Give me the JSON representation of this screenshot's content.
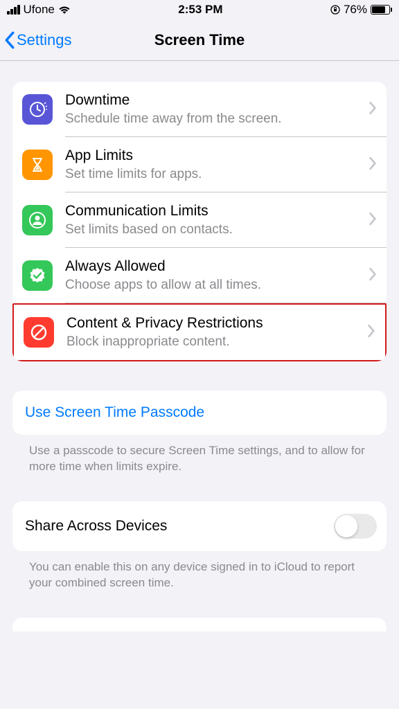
{
  "status": {
    "carrier": "Ufone",
    "time": "2:53 PM",
    "battery_percent": "76%"
  },
  "nav": {
    "back_label": "Settings",
    "title": "Screen Time"
  },
  "rows": [
    {
      "title": "Downtime",
      "sub": "Schedule time away from the screen."
    },
    {
      "title": "App Limits",
      "sub": "Set time limits for apps."
    },
    {
      "title": "Communication Limits",
      "sub": "Set limits based on contacts."
    },
    {
      "title": "Always Allowed",
      "sub": "Choose apps to allow at all times."
    },
    {
      "title": "Content & Privacy Restrictions",
      "sub": "Block inappropriate content."
    }
  ],
  "passcode": {
    "label": "Use Screen Time Passcode",
    "footer": "Use a passcode to secure Screen Time settings, and to allow for more time when limits expire."
  },
  "share": {
    "label": "Share Across Devices",
    "footer": "You can enable this on any device signed in to iCloud to report your combined screen time."
  }
}
